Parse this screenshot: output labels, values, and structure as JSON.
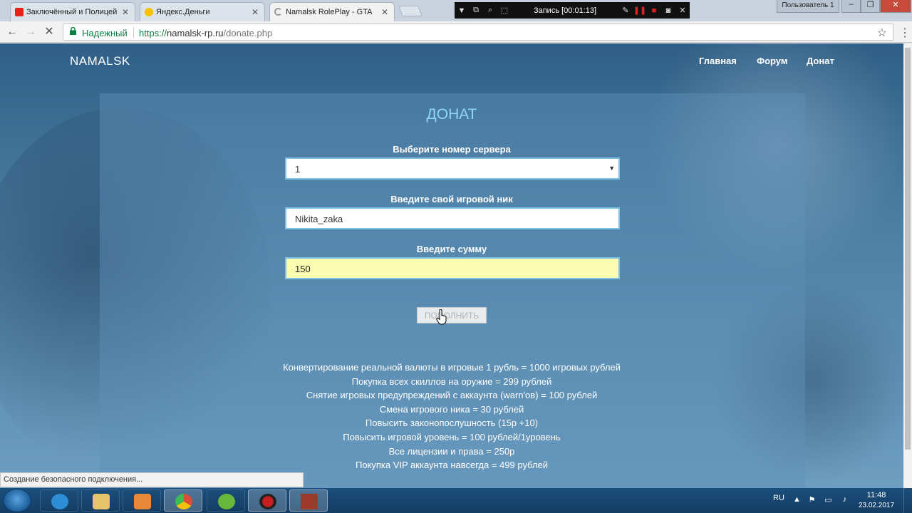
{
  "browser": {
    "tabs": [
      {
        "title": "Заключённый и Полицей",
        "favicon_color": "#e62117"
      },
      {
        "title": "Яндекс.Деньги",
        "favicon_color": "#f7c200"
      },
      {
        "title": "Namalsk RolePlay - GTA",
        "favicon_color": "#9a9a9a"
      }
    ],
    "tab_close_glyph": "✕",
    "recorder_label": "Запись [00:01:13]",
    "user_badge": "Пользователь 1",
    "window_buttons": {
      "minimize": "–",
      "maximize": "❐",
      "close": "✕"
    },
    "nav": {
      "back": "←",
      "forward": "→",
      "reload": "✕"
    },
    "security_label": "Надежный",
    "url_scheme": "https://",
    "url_host": "namalsk-rp.ru",
    "url_path": "/donate.php",
    "bookmark_glyph": "☆",
    "menu_glyph": "⋮",
    "status_text": "Создание безопасного подключения..."
  },
  "site": {
    "brand": "NAMALSK",
    "nav": [
      "Главная",
      "Форум",
      "Донат"
    ],
    "title": "ДОНАТ",
    "form": {
      "server_label": "Выберите номер сервера",
      "server_value": "1",
      "select_arrow": "▼",
      "nick_label": "Введите свой игровой ник",
      "nick_value": "Nikita_zaka",
      "amount_label": "Введите сумму",
      "amount_value": "150",
      "submit_label": "ПОПОЛНИТЬ"
    },
    "info_lines": [
      "Конвертирование реальной валюты в игровые 1 рубль = 1000 игровых рублей",
      "Покупка всех скиллов на оружие = 299 рублей",
      "Снятие игровых предупреждений с аккаунта (warn'ов) = 100 рублей",
      "Смена игрового ника = 30 рублей",
      "Повысить законопослушность (15р +10)",
      "Повысить игровой уровень = 100 рублей/1уровень",
      "Все лицензии и права = 250р",
      "Покупка VIP аккаунта навсегда = 499 рублей"
    ]
  },
  "taskbar": {
    "apps": [
      {
        "name": "internet-explorer",
        "color": "#2b8ed6"
      },
      {
        "name": "file-explorer",
        "color": "#e7c46a"
      },
      {
        "name": "media-player",
        "color": "#e8893a"
      },
      {
        "name": "chrome",
        "color": "#dd4b39"
      },
      {
        "name": "utorrent",
        "color": "#69b83e"
      },
      {
        "name": "recorder",
        "color": "#c81e1e"
      },
      {
        "name": "minecraft",
        "color": "#9c3b2c"
      }
    ],
    "language": "RU",
    "tray_glyphs": [
      "▲",
      "⚑",
      "▭",
      "♪"
    ],
    "time": "11:48",
    "date": "23.02.2017"
  }
}
